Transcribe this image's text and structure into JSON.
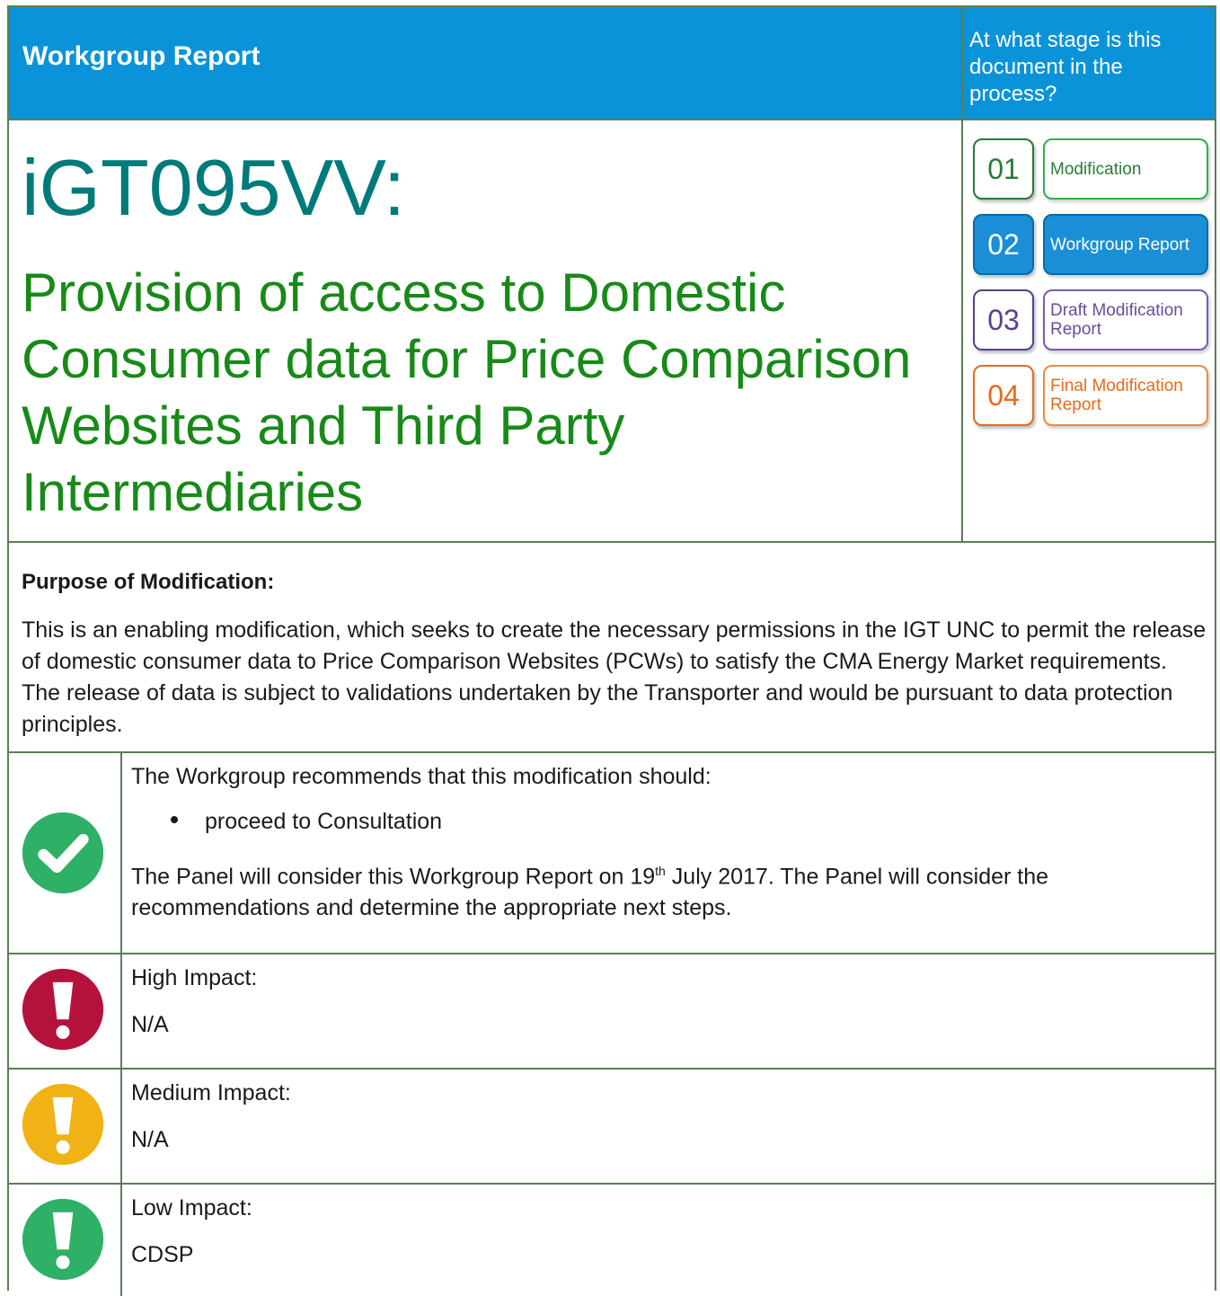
{
  "header": {
    "title": "Workgroup Report",
    "stage_question": "At what stage is this document in the process?"
  },
  "document": {
    "code": "iGT095VV:",
    "title": "Provision of access to Domestic Consumer data for Price Comparison Websites and Third Party Intermediaries"
  },
  "stages": [
    {
      "number": "01",
      "label": "Modification",
      "color": "#2eb04d"
    },
    {
      "number": "02",
      "label": "Workgroup Report",
      "color": "#1a8fd6"
    },
    {
      "number": "03",
      "label": "Draft Modification Report",
      "color": "#7a5ab0"
    },
    {
      "number": "04",
      "label": "Final Modification Report",
      "color": "#f08a3a"
    }
  ],
  "purpose": {
    "heading": "Purpose of Modification:",
    "text": "This is an enabling modification, which seeks to create the necessary permissions in the IGT UNC to permit the release of domestic consumer data to Price Comparison Websites (PCWs) to satisfy the CMA Energy Market requirements.  The release of data is subject to validations undertaken by the Transporter and would be pursuant to data protection principles."
  },
  "recommendation": {
    "intro": "The Workgroup recommends that this modification should:",
    "bullet": "proceed to Consultation",
    "panel_before": "The Panel will consider this Workgroup Report on 19",
    "panel_sup": "th",
    "panel_after": " July 2017.  The Panel will consider the recommendations and determine the appropriate next steps.",
    "icon": "check-circle-icon",
    "icon_color": "#2eb067"
  },
  "impacts": {
    "high": {
      "label": "High Impact:",
      "value": "N/A",
      "icon": "exclamation-circle-icon",
      "color": "#b5123b"
    },
    "medium": {
      "label": "Medium Impact:",
      "value": "N/A",
      "icon": "exclamation-circle-icon",
      "color": "#f0b214"
    },
    "low": {
      "label": "Low Impact:",
      "value": "CDSP",
      "icon": "exclamation-circle-icon",
      "color": "#2eb067"
    }
  }
}
